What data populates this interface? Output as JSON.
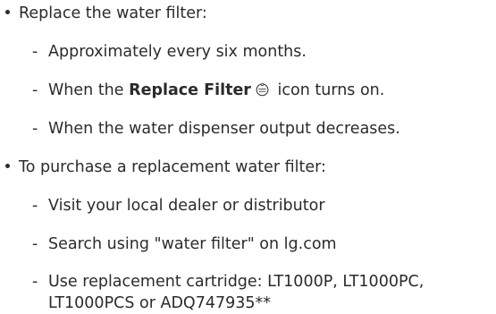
{
  "section1": {
    "heading": "Replace the water filter:",
    "items": [
      {
        "dash": "-",
        "text": "Approximately every six months."
      },
      {
        "dash": "-",
        "text_before": "When the ",
        "bold": "Replace Filter",
        "icon": "replace-filter-icon",
        "text_after": " icon turns on."
      },
      {
        "dash": "-",
        "text": "When the water dispenser output decreases."
      }
    ]
  },
  "section2": {
    "heading": "To purchase a replacement water filter:",
    "items": [
      {
        "dash": "-",
        "text": "Visit your local dealer or distributor"
      },
      {
        "dash": "-",
        "text": "Search using \"water filter\" on lg.com"
      },
      {
        "dash": "-",
        "text": "Use replacement cartridge: LT1000P, LT1000PC, LT1000PCS or ADQ747935**"
      }
    ]
  }
}
